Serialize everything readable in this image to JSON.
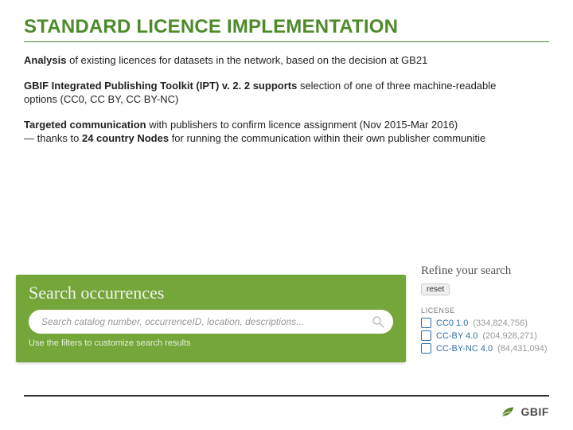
{
  "title": "STANDARD LICENCE IMPLEMENTATION",
  "paragraphs": {
    "p1_strong": "Analysis",
    "p1_rest": " of existing licences for datasets in the network, based on the decision at GB21",
    "p2_strong": "GBIF Integrated Publishing Toolkit (IPT)  v. 2. 2 supports",
    "p2_rest": " selection of one of three machine-readable options (CC0, CC BY, CC BY-NC)",
    "p3_strong1": "Targeted communication",
    "p3_mid": " with publishers to confirm licence assignment (Nov 2015-Mar 2016)",
    "p3_break": " — thanks to ",
    "p3_strong2": "24 country Nodes",
    "p3_tail": " for running the communication within their own publisher communitie"
  },
  "search": {
    "title": "Search occurrences",
    "placeholder": "Search catalog number, occurrenceID, location, descriptions...",
    "hint": "Use the filters to customize search results"
  },
  "refine": {
    "title": "Refine your search",
    "reset": "reset",
    "section": "LICENSE",
    "items": [
      {
        "name": "CC0 1.0",
        "count": "(334,824,756)"
      },
      {
        "name": "CC-BY 4.0",
        "count": "(204,928,271)"
      },
      {
        "name": "CC-BY-NC 4.0",
        "count": "(84,431,094)"
      }
    ]
  },
  "logo_text": "GBIF"
}
